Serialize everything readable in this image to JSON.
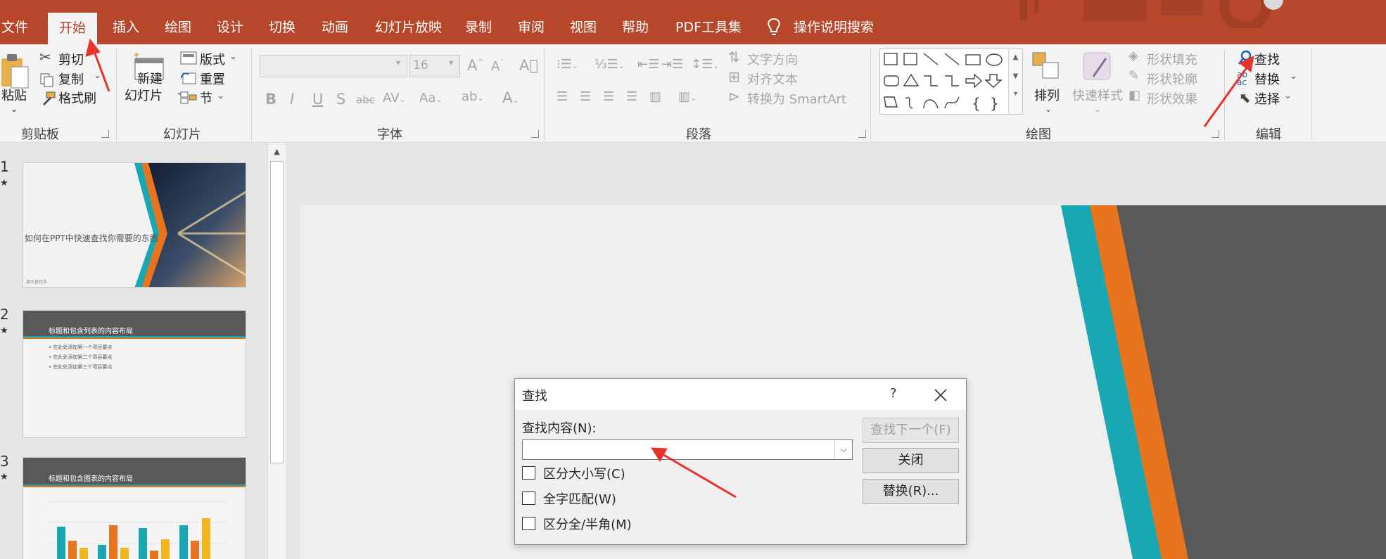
{
  "tabs": [
    "文件",
    "开始",
    "插入",
    "绘图",
    "设计",
    "切换",
    "动画",
    "幻灯片放映",
    "录制",
    "审阅",
    "视图",
    "帮助",
    "PDF工具集"
  ],
  "active_tab": "开始",
  "tell_me": "操作说明搜索",
  "clipboard": {
    "paste": "粘贴",
    "cut": "剪切",
    "copy": "复制",
    "format_painter": "格式刷",
    "label": "剪贴板"
  },
  "slides_group": {
    "new_slide_1": "新建",
    "new_slide_2": "幻灯片",
    "layout": "版式",
    "reset": "重置",
    "section": "节",
    "label": "幻灯片"
  },
  "font": {
    "size_value": "16",
    "label": "字体"
  },
  "paragraph": {
    "text_direction": "文字方向",
    "align_text": "对齐文本",
    "smartart": "转换为 SmartArt",
    "label": "段落"
  },
  "drawing": {
    "arrange": "排列",
    "quick_styles": "快速样式",
    "fill": "形状填充",
    "outline": "形状轮廓",
    "effects": "形状效果",
    "label": "绘图"
  },
  "editing": {
    "find": "查找",
    "replace": "替换",
    "select": "选择",
    "label": "编辑"
  },
  "thumbnails": [
    {
      "num": "1",
      "title": "如何在PPT中快速查找你需要的东西",
      "footer": "演示者姓名"
    },
    {
      "num": "2",
      "title": "标题和包含列表的内容布局",
      "bullets": [
        "在此处添加第一个项目要点",
        "在此处添加第二个项目要点",
        "在此处添加第三个项目要点"
      ]
    },
    {
      "num": "3",
      "title": "标题和包含图表的内容布局"
    }
  ],
  "dialog": {
    "title": "查找",
    "help": "?",
    "find_what_label": "查找内容(N):",
    "find_what_value": "",
    "match_case": "区分大小写(C)",
    "whole_words": "全字匹配(W)",
    "match_width": "区分全/半角(M)",
    "find_next": "查找下一个(F)",
    "close": "关闭",
    "replace": "替换(R)..."
  },
  "colors": {
    "brand": "#b7472a",
    "teal": "#1aa7b4",
    "orange": "#e8741e",
    "dark": "#595959",
    "annotation": "#e8322c"
  }
}
